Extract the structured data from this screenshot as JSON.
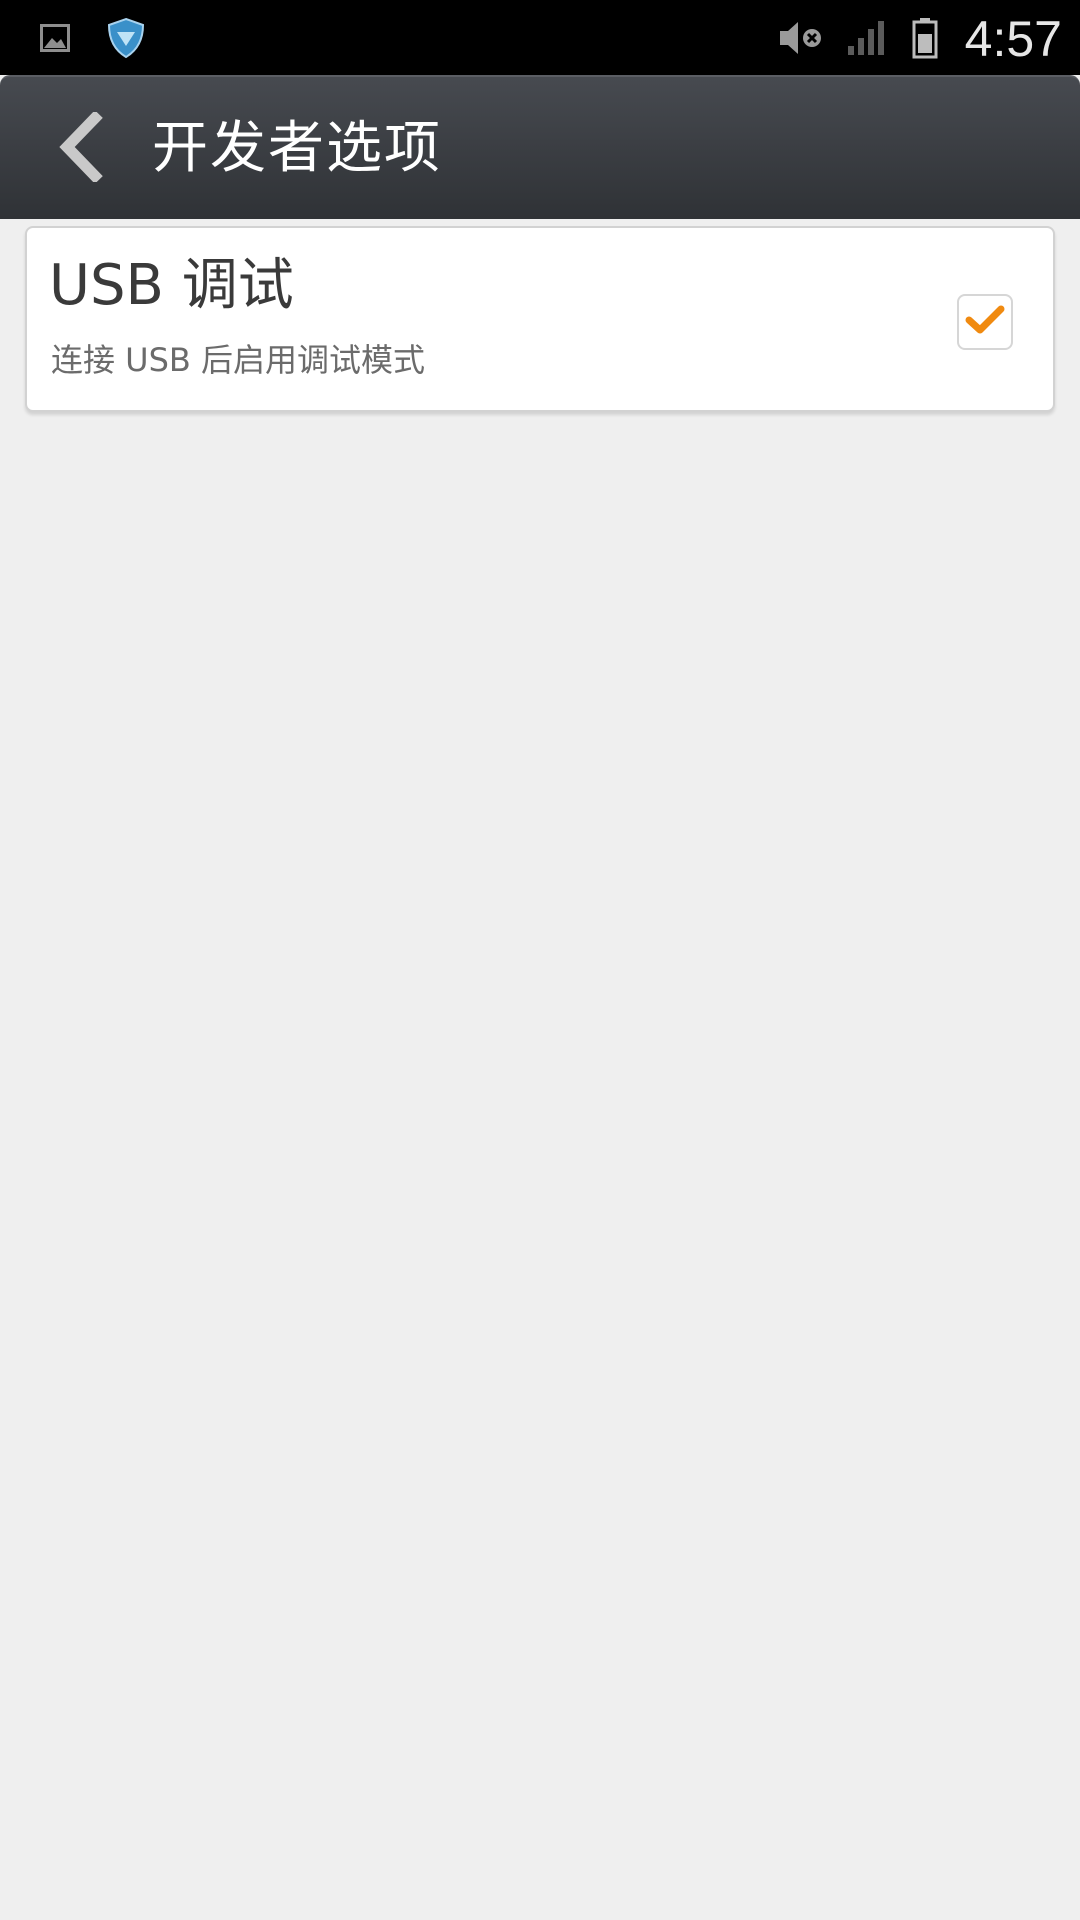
{
  "status_bar": {
    "time": "4:57",
    "left_icons": [
      "gallery-notification-icon",
      "shield-icon"
    ],
    "right_icons": [
      "volume-muted-icon",
      "signal-icon",
      "battery-icon"
    ]
  },
  "action_bar": {
    "title": "开发者选项",
    "back_icon": "chevron-left-icon"
  },
  "settings": {
    "usb_debugging": {
      "title": "USB 调试",
      "summary": "连接 USB 后启用调试模式",
      "checked": true
    }
  },
  "colors": {
    "accent": "#f08a10",
    "background": "#efefef",
    "action_bar": "#3b3e43"
  }
}
